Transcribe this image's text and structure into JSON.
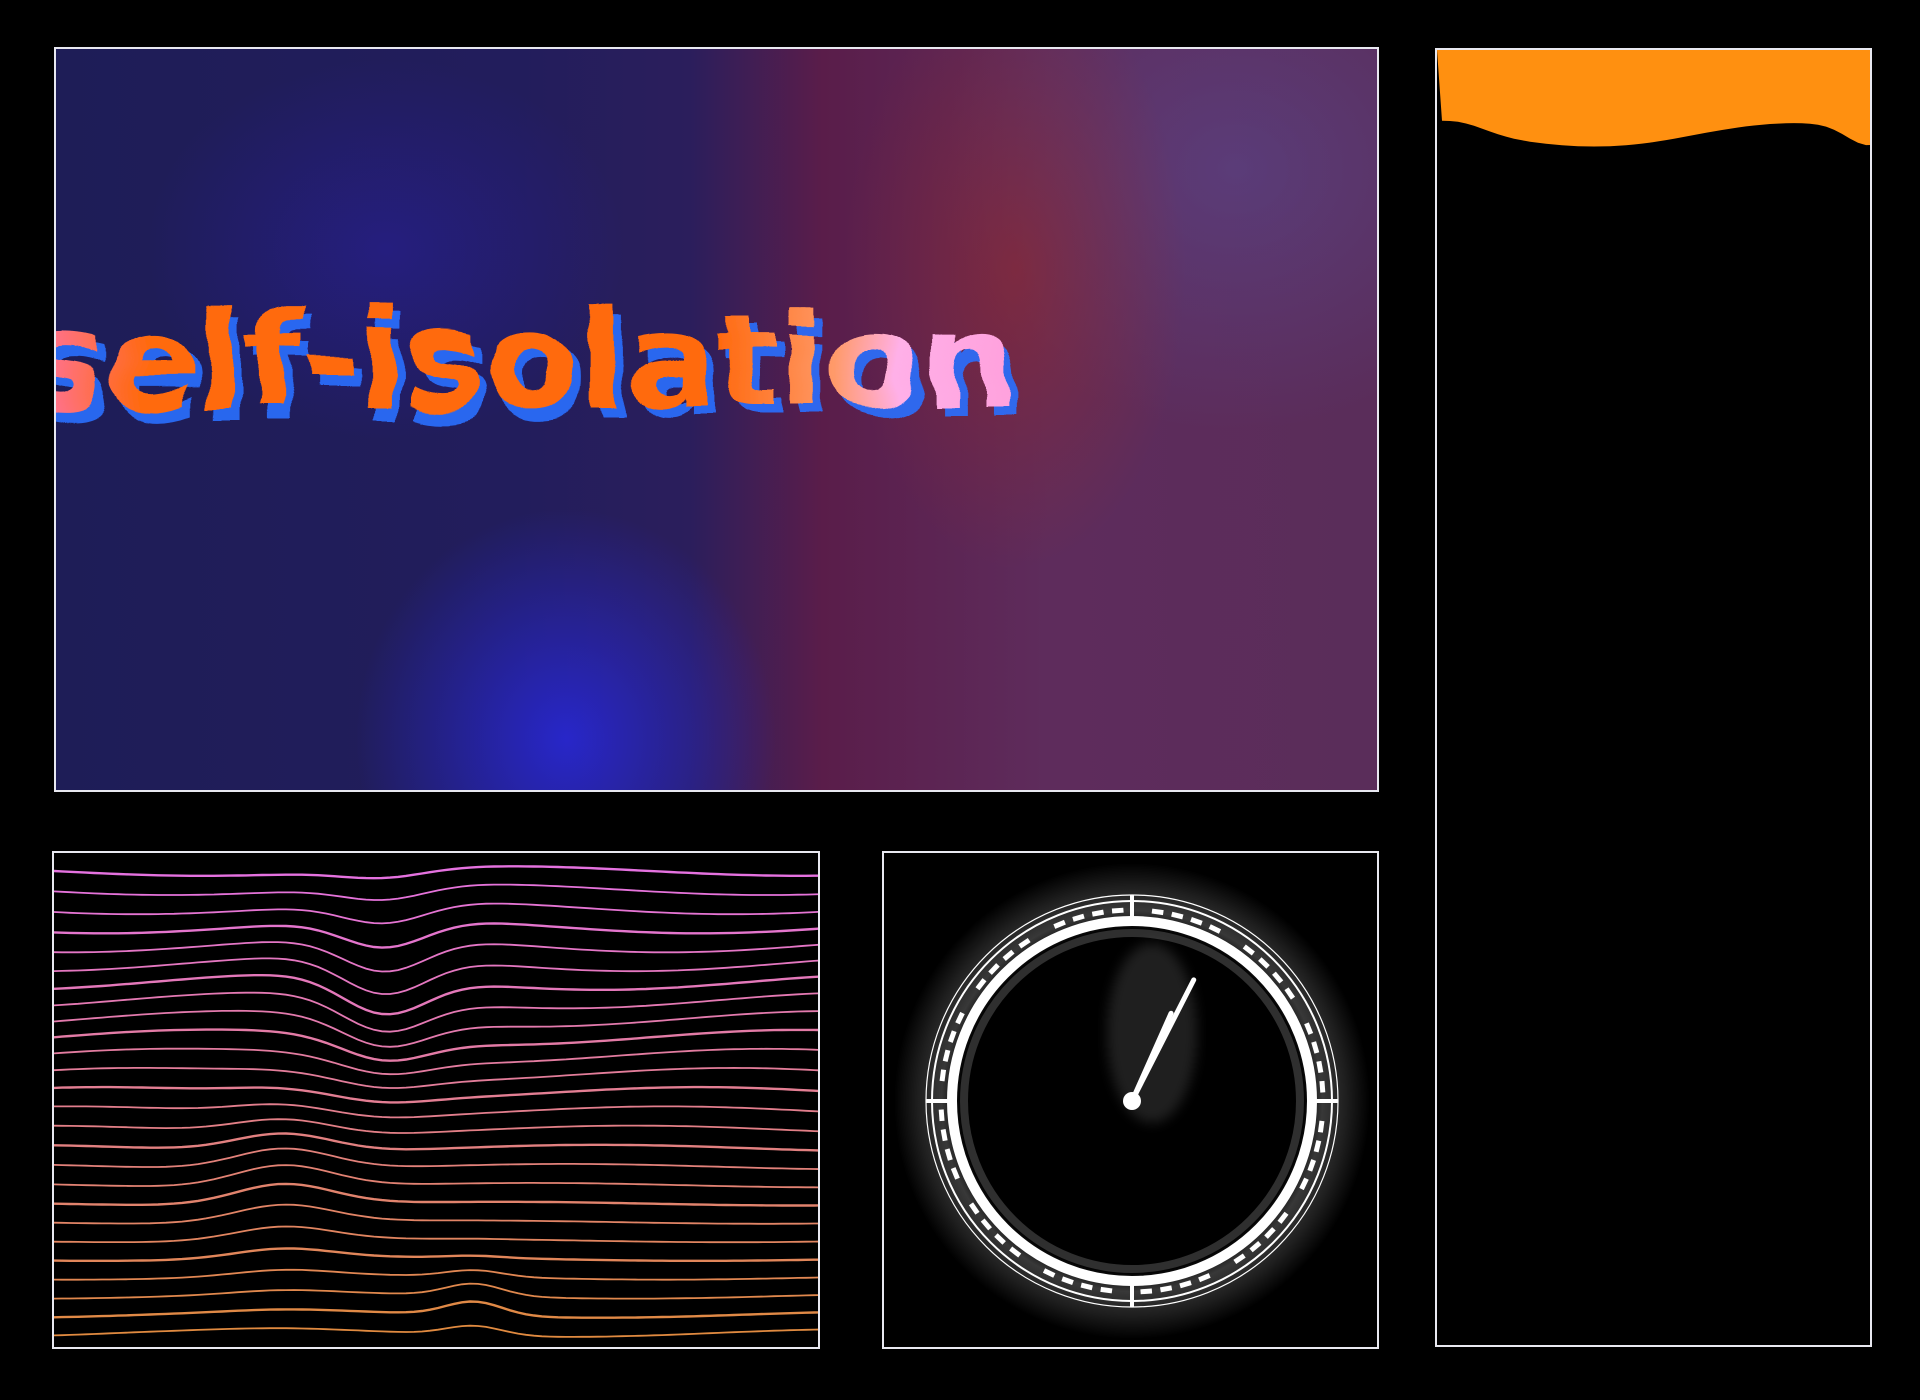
{
  "hero": {
    "title": "self-isolation"
  },
  "colors": {
    "frame_border": "#e8e8f0",
    "title_orange": "#ff6a10",
    "title_pink": "#ff74b0",
    "title_light_pink": "#ffb0e8",
    "title_blue_shadow": "#2a70ff",
    "wave_top": "#e572e0",
    "wave_bottom": "#e08a40",
    "level_fill": "#ff9010",
    "clock_white": "#ffffff"
  },
  "clock": {
    "hour_hand_icon": "hour-hand",
    "minute_hand_icon": "minute-hand",
    "hour_value": 0.9,
    "minute_value": 4
  },
  "level_meter": {
    "fill_fraction": 0.06
  }
}
